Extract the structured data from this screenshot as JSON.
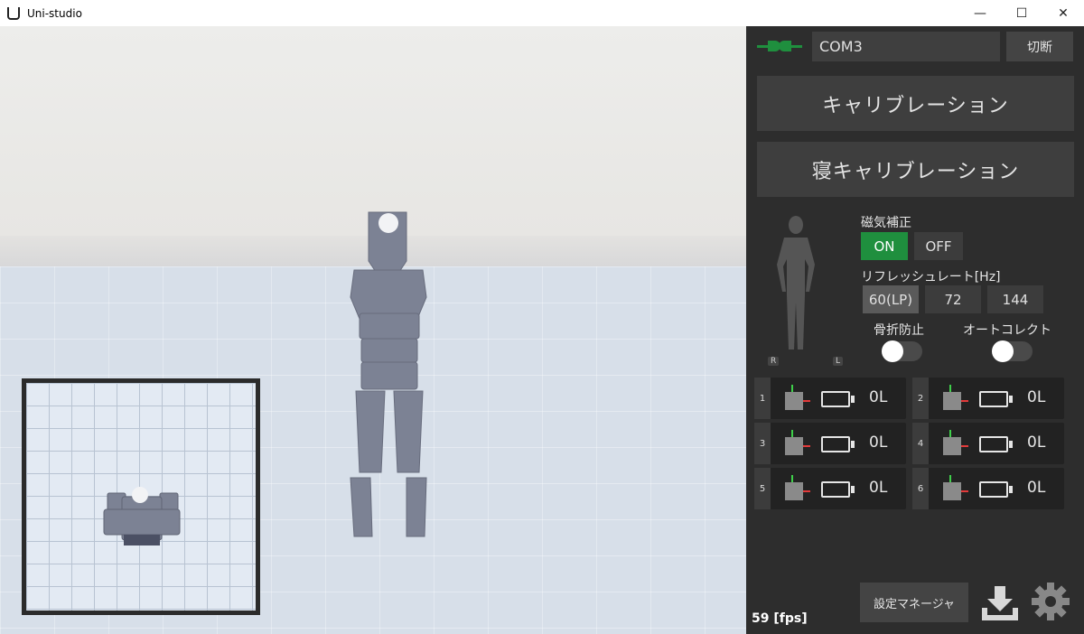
{
  "window": {
    "title": "Uni-studio",
    "min_glyph": "—",
    "max_glyph": "☐",
    "close_glyph": "✕"
  },
  "connection": {
    "port": "COM3",
    "disconnect_label": "切断",
    "plug_color": "#1f8f3e"
  },
  "buttons": {
    "calibration": "キャリブレーション",
    "sleep_calibration": "寝キャリブレーション"
  },
  "magnetic": {
    "label": "磁気補正",
    "on": "ON",
    "off": "OFF",
    "selected": "ON"
  },
  "refresh": {
    "label": "リフレッシュレート[Hz]",
    "options": [
      "60(LP)",
      "72",
      "144"
    ],
    "selected": "60(LP)"
  },
  "toggles": {
    "fracture_label": "骨折防止",
    "autocorrect_label": "オートコレクト"
  },
  "body_markers": {
    "right": "R",
    "left": "L"
  },
  "sensors": [
    {
      "id": "1",
      "value": "0L"
    },
    {
      "id": "2",
      "value": "0L"
    },
    {
      "id": "3",
      "value": "0L"
    },
    {
      "id": "4",
      "value": "0L"
    },
    {
      "id": "5",
      "value": "0L"
    },
    {
      "id": "6",
      "value": "0L"
    }
  ],
  "footer": {
    "fps": "59 [fps]",
    "settings_manager": "設定マネージャ"
  },
  "colors": {
    "panel_bg": "#2d2d2d",
    "accent_green": "#1f8f3e"
  }
}
